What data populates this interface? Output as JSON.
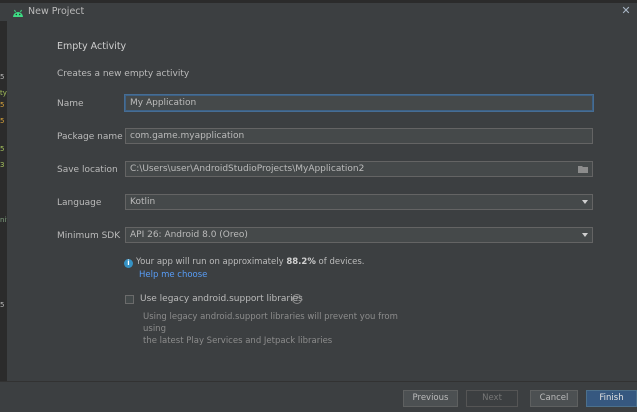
{
  "window": {
    "title": "New Project",
    "close_glyph": "✕"
  },
  "left_edge_marks": [
    "5",
    "ty",
    "5",
    "5",
    "5",
    "3",
    "nit",
    "5"
  ],
  "page": {
    "heading": "Empty Activity",
    "description": "Creates a new empty activity"
  },
  "form": {
    "name": {
      "label": "Name",
      "value": "My Application"
    },
    "package": {
      "label": "Package name",
      "value": "com.game.myapplication"
    },
    "save_location": {
      "label": "Save location",
      "value": "C:\\Users\\user\\AndroidStudioProjects\\MyApplication2"
    },
    "language": {
      "label": "Language",
      "value": "Kotlin"
    },
    "min_sdk": {
      "label": "Minimum SDK",
      "value": "API 26: Android 8.0 (Oreo)"
    }
  },
  "info": {
    "prefix": "Your app will run on approximately ",
    "percent": "88.2%",
    "suffix": " of devices.",
    "help_link": "Help me choose"
  },
  "legacy": {
    "label": "Use legacy android.support libraries",
    "checked": false,
    "help_glyph": "?",
    "description_line1": "Using legacy android.support libraries will prevent you from using",
    "description_line2": "the latest Play Services and Jetpack libraries"
  },
  "buttons": {
    "previous": "Previous",
    "next": "Next",
    "cancel": "Cancel",
    "finish": "Finish"
  },
  "colors": {
    "android_green": "#3ddc84",
    "link": "#589df6",
    "info_blue": "#3592c4",
    "primary_button": "#365880"
  }
}
